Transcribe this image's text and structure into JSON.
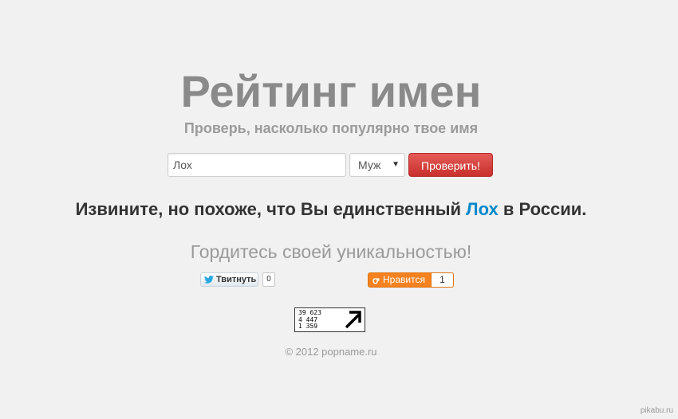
{
  "header": {
    "title": "Рейтинг имен",
    "subtitle": "Проверь, насколько популярно твое имя"
  },
  "form": {
    "name_value": "Лох",
    "gender_selected": "Муж",
    "check_button_label": "Проверить!"
  },
  "result": {
    "prefix": "Извините, но похоже, что Вы единственный ",
    "name": "Лох",
    "suffix": " в России.",
    "proud_text": "Гордитесь своей уникальностью!"
  },
  "social": {
    "tweet_label": "Твитнуть",
    "tweet_count": "0",
    "ok_label": "Нравится",
    "ok_count": "1"
  },
  "counter": {
    "line1": "39 623",
    "line2": "4 447",
    "line3": "1 359"
  },
  "footer": {
    "copyright": "© 2012 popname.ru",
    "watermark": "pikabu.ru"
  },
  "colors": {
    "accent_blue": "#0088cc",
    "button_red": "#d9534f",
    "ok_orange": "#f58220"
  }
}
